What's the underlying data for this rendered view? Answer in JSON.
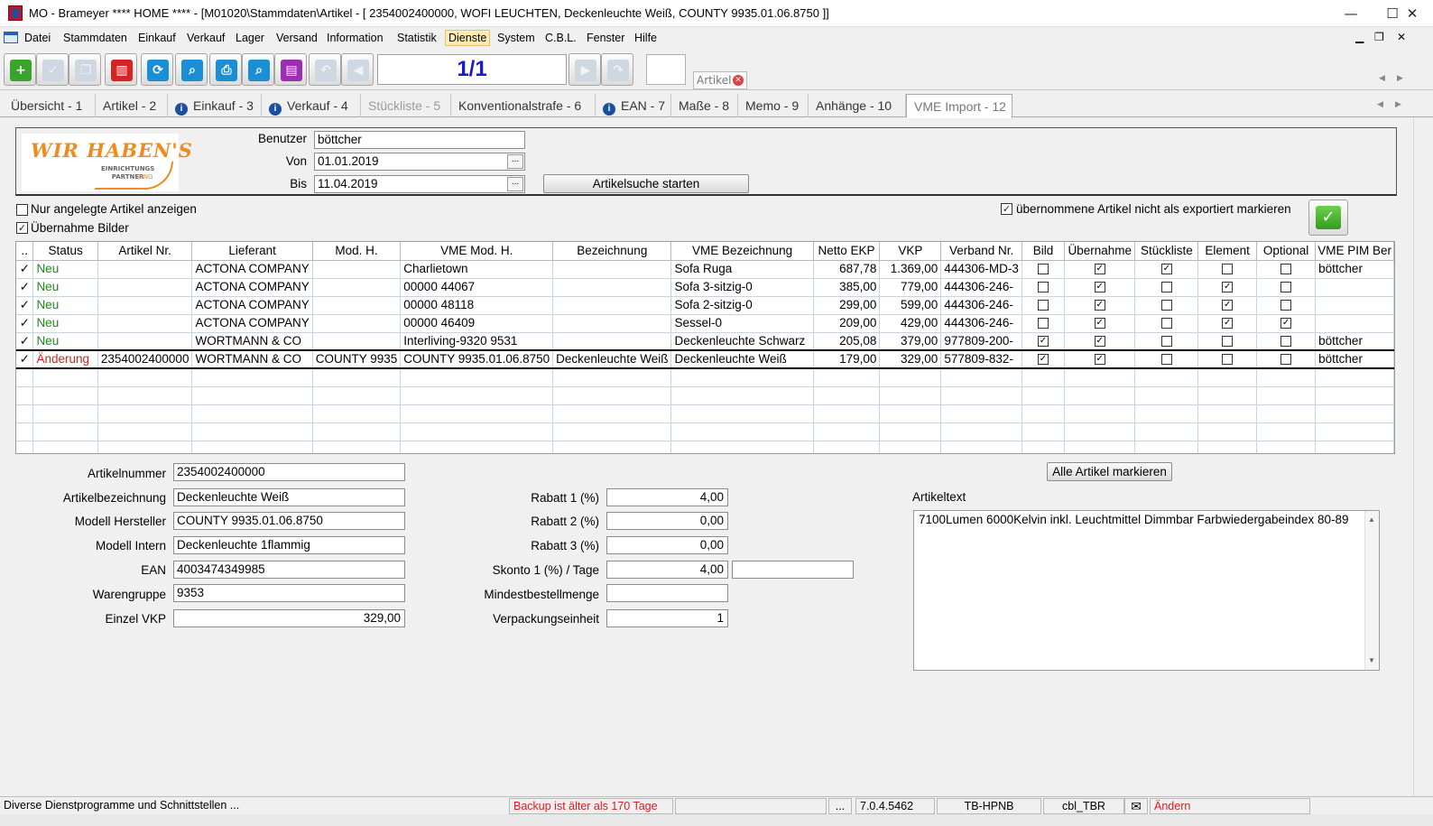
{
  "window": {
    "title": "MO - Brameyer **** HOME **** - [M01020\\Stammdaten\\Artikel - [ 2354002400000, WOFI LEUCHTEN, Deckenleuchte Weiß, COUNTY 9935.01.06.8750 ]]",
    "minimize": "—",
    "maximize": "☐",
    "close": "✕"
  },
  "menu": {
    "items": [
      "Datei",
      "Stammdaten",
      "Einkauf",
      "Verkauf",
      "Lager",
      "Versand",
      "Information",
      "Statistik",
      "Dienste",
      "System",
      "C.B.L.",
      "Fenster",
      "Hilfe"
    ],
    "active": "Dienste",
    "mdi_min": "▁",
    "mdi_restore": "❐",
    "mdi_close": "✕"
  },
  "toolbar": {
    "counter": "1/1",
    "doc_tab": "Artikel",
    "doc_tab_close": "✕",
    "icons": [
      "new-icon",
      "save-icon",
      "copy-icon",
      "delete-icon",
      "refresh-icon",
      "search-icon",
      "print-icon",
      "preview-icon",
      "form-icon",
      "undo-icon",
      "back-icon",
      "forward-icon",
      "redo-icon"
    ],
    "glyphs": {
      "new": "+",
      "save": "✓",
      "copy": "❐",
      "delete": "▥",
      "refresh": "⟳",
      "search": "⌕",
      "print": "⎙",
      "preview": "⌕",
      "form": "▤",
      "undo": "↶",
      "back": "◀",
      "forward": "▶",
      "redo": "↷"
    },
    "colors": {
      "new": "#3aa32b",
      "delete": "#d42424",
      "refresh": "#1b8fd6",
      "search": "#1b8fd6",
      "print": "#1b8fd6",
      "preview": "#1b8fd6",
      "form": "#9a2fb5"
    },
    "scroll_left": "◀",
    "scroll_right": "▶"
  },
  "tabs": [
    {
      "label": "Übersicht - 1",
      "info": false,
      "state": "normal"
    },
    {
      "label": "Artikel - 2",
      "info": false,
      "state": "normal"
    },
    {
      "label": "Einkauf - 3",
      "info": true,
      "state": "normal"
    },
    {
      "label": "Verkauf - 4",
      "info": true,
      "state": "normal"
    },
    {
      "label": "Stückliste - 5",
      "info": false,
      "state": "disabled"
    },
    {
      "label": "Konventionalstrafe - 6",
      "info": false,
      "state": "normal"
    },
    {
      "label": "EAN - 7",
      "info": true,
      "state": "normal"
    },
    {
      "label": "Maße - 8",
      "info": false,
      "state": "normal"
    },
    {
      "label": "Memo - 9",
      "info": false,
      "state": "normal"
    },
    {
      "label": "Anhänge - 10",
      "info": false,
      "state": "normal"
    },
    {
      "label": "VME Import - 12",
      "info": false,
      "state": "active"
    }
  ],
  "tab_info_glyph": "i",
  "logo": {
    "line1": "WIR HABEN'S",
    "line2": "EINRICHTUNGS",
    "line3": "PARTNER",
    "line4": "RING"
  },
  "filter": {
    "user_label": "Benutzer",
    "user_value": "böttcher",
    "from_label": "Von",
    "from_value": "01.01.2019",
    "to_label": "Bis",
    "to_value": "11.04.2019",
    "dots": "...",
    "search_button": "Artikelsuche starten"
  },
  "options": {
    "only_created_label": "Nur angelegte Artikel anzeigen",
    "only_created_checked": false,
    "take_images_label": "Übernahme Bilder",
    "take_images_checked": true,
    "not_exported_label": "übernommene Artikel nicht als exportiert markieren",
    "not_exported_checked": true,
    "check_glyph": "✓"
  },
  "grid": {
    "columns": [
      "..",
      "Status",
      "Artikel Nr.",
      "Lieferant",
      "Mod. H.",
      "VME Mod. H.",
      "Bezeichnung",
      "VME Bezeichnung",
      "Netto EKP",
      "VKP",
      "Verband Nr.",
      "Bild",
      "Übernahme",
      "Stückliste",
      "Element",
      "Optional",
      "VME PIM Ber"
    ],
    "rows": [
      {
        "mark": "✓",
        "status": "Neu",
        "type": "new",
        "artnr": "",
        "lieferant": "ACTONA COMPANY",
        "modh": "",
        "vmemodh": "Charlietown",
        "bez": "",
        "vmebez": "Sofa Ruga",
        "netto": "687,78",
        "vkp": "1.369,00",
        "verband": "444306-MD-3",
        "bild": false,
        "uebernahme": true,
        "stueckliste": true,
        "element": false,
        "optional": false,
        "pim": "böttcher"
      },
      {
        "mark": "✓",
        "status": "Neu",
        "type": "new",
        "artnr": "",
        "lieferant": "ACTONA COMPANY",
        "modh": "",
        "vmemodh": " 00000 44067",
        "bez": "",
        "vmebez": "Sofa 3-sitzig-0",
        "netto": "385,00",
        "vkp": "779,00",
        "verband": "444306-246-",
        "bild": false,
        "uebernahme": true,
        "stueckliste": false,
        "element": true,
        "optional": false,
        "pim": ""
      },
      {
        "mark": "✓",
        "status": "Neu",
        "type": "new",
        "artnr": "",
        "lieferant": "ACTONA COMPANY",
        "modh": "",
        "vmemodh": " 00000 48118",
        "bez": "",
        "vmebez": "Sofa 2-sitzig-0",
        "netto": "299,00",
        "vkp": "599,00",
        "verband": "444306-246-",
        "bild": false,
        "uebernahme": true,
        "stueckliste": false,
        "element": true,
        "optional": false,
        "pim": ""
      },
      {
        "mark": "✓",
        "status": "Neu",
        "type": "new",
        "artnr": "",
        "lieferant": "ACTONA COMPANY",
        "modh": "",
        "vmemodh": " 00000 46409",
        "bez": "",
        "vmebez": "Sessel-0",
        "netto": "209,00",
        "vkp": "429,00",
        "verband": "444306-246-",
        "bild": false,
        "uebernahme": true,
        "stueckliste": false,
        "element": true,
        "optional": true,
        "pim": ""
      },
      {
        "mark": "✓",
        "status": "Neu",
        "type": "new",
        "artnr": "",
        "lieferant": "WORTMANN & CO",
        "modh": "",
        "vmemodh": "Interliving-9320 9531",
        "bez": "",
        "vmebez": "Deckenleuchte Schwarz",
        "netto": "205,08",
        "vkp": "379,00",
        "verband": "977809-200-",
        "bild": true,
        "uebernahme": true,
        "stueckliste": false,
        "element": false,
        "optional": false,
        "pim": "böttcher"
      },
      {
        "mark": "✓",
        "status": "Änderung",
        "type": "change",
        "artnr": "2354002400000",
        "lieferant": "WORTMANN & CO",
        "modh": "COUNTY 9935",
        "vmemodh": "COUNTY 9935.01.06.8750",
        "bez": "Deckenleuchte Weiß",
        "vmebez": "Deckenleuchte Weiß",
        "netto": "179,00",
        "vkp": "329,00",
        "verband": "577809-832-",
        "bild": true,
        "uebernahme": true,
        "stueckliste": false,
        "element": false,
        "optional": false,
        "pim": "böttcher"
      }
    ],
    "empty_rows": 5,
    "check_glyph": "✓"
  },
  "detail": {
    "artikelnummer_label": "Artikelnummer",
    "artikelnummer": "2354002400000",
    "artikelbezeichnung_label": "Artikelbezeichnung",
    "artikelbezeichnung": "Deckenleuchte Weiß",
    "modell_hersteller_label": "Modell Hersteller",
    "modell_hersteller": "COUNTY 9935.01.06.8750",
    "modell_intern_label": "Modell Intern",
    "modell_intern": "Deckenleuchte 1flammig",
    "ean_label": "EAN",
    "ean": "4003474349985",
    "warengruppe_label": "Warengruppe",
    "warengruppe": "9353",
    "einzel_vkp_label": "Einzel VKP",
    "einzel_vkp": "329,00",
    "rabatt1_label": "Rabatt 1 (%)",
    "rabatt1": "4,00",
    "rabatt2_label": "Rabatt 2 (%)",
    "rabatt2": "0,00",
    "rabatt3_label": "Rabatt 3 (%)",
    "rabatt3": "0,00",
    "skonto_label": "Skonto 1 (%) / Tage",
    "skonto": "4,00",
    "skonto_tage": "",
    "mindest_label": "Mindestbestellmenge",
    "mindest": "",
    "vpe_label": "Verpackungseinheit",
    "vpe": "1",
    "mark_all_button": "Alle Artikel markieren",
    "artikeltext_label": "Artikeltext",
    "artikeltext": "7100Lumen 6000Kelvin inkl. Leuchtmittel Dimmbar Farbwiedergabeindex 80-89",
    "scroll_up": "▲",
    "scroll_down": "▼"
  },
  "statusbar": {
    "hint": "Diverse Dienstprogramme und Schnittstellen ...",
    "backup": "Backup ist älter als 170 Tage",
    "empty": "",
    "dots": "...",
    "version": "7.0.4.5462",
    "host": "TB-HPNB",
    "db": "cbl_TBR",
    "mail_icon": "✉",
    "mode": "Ändern"
  }
}
